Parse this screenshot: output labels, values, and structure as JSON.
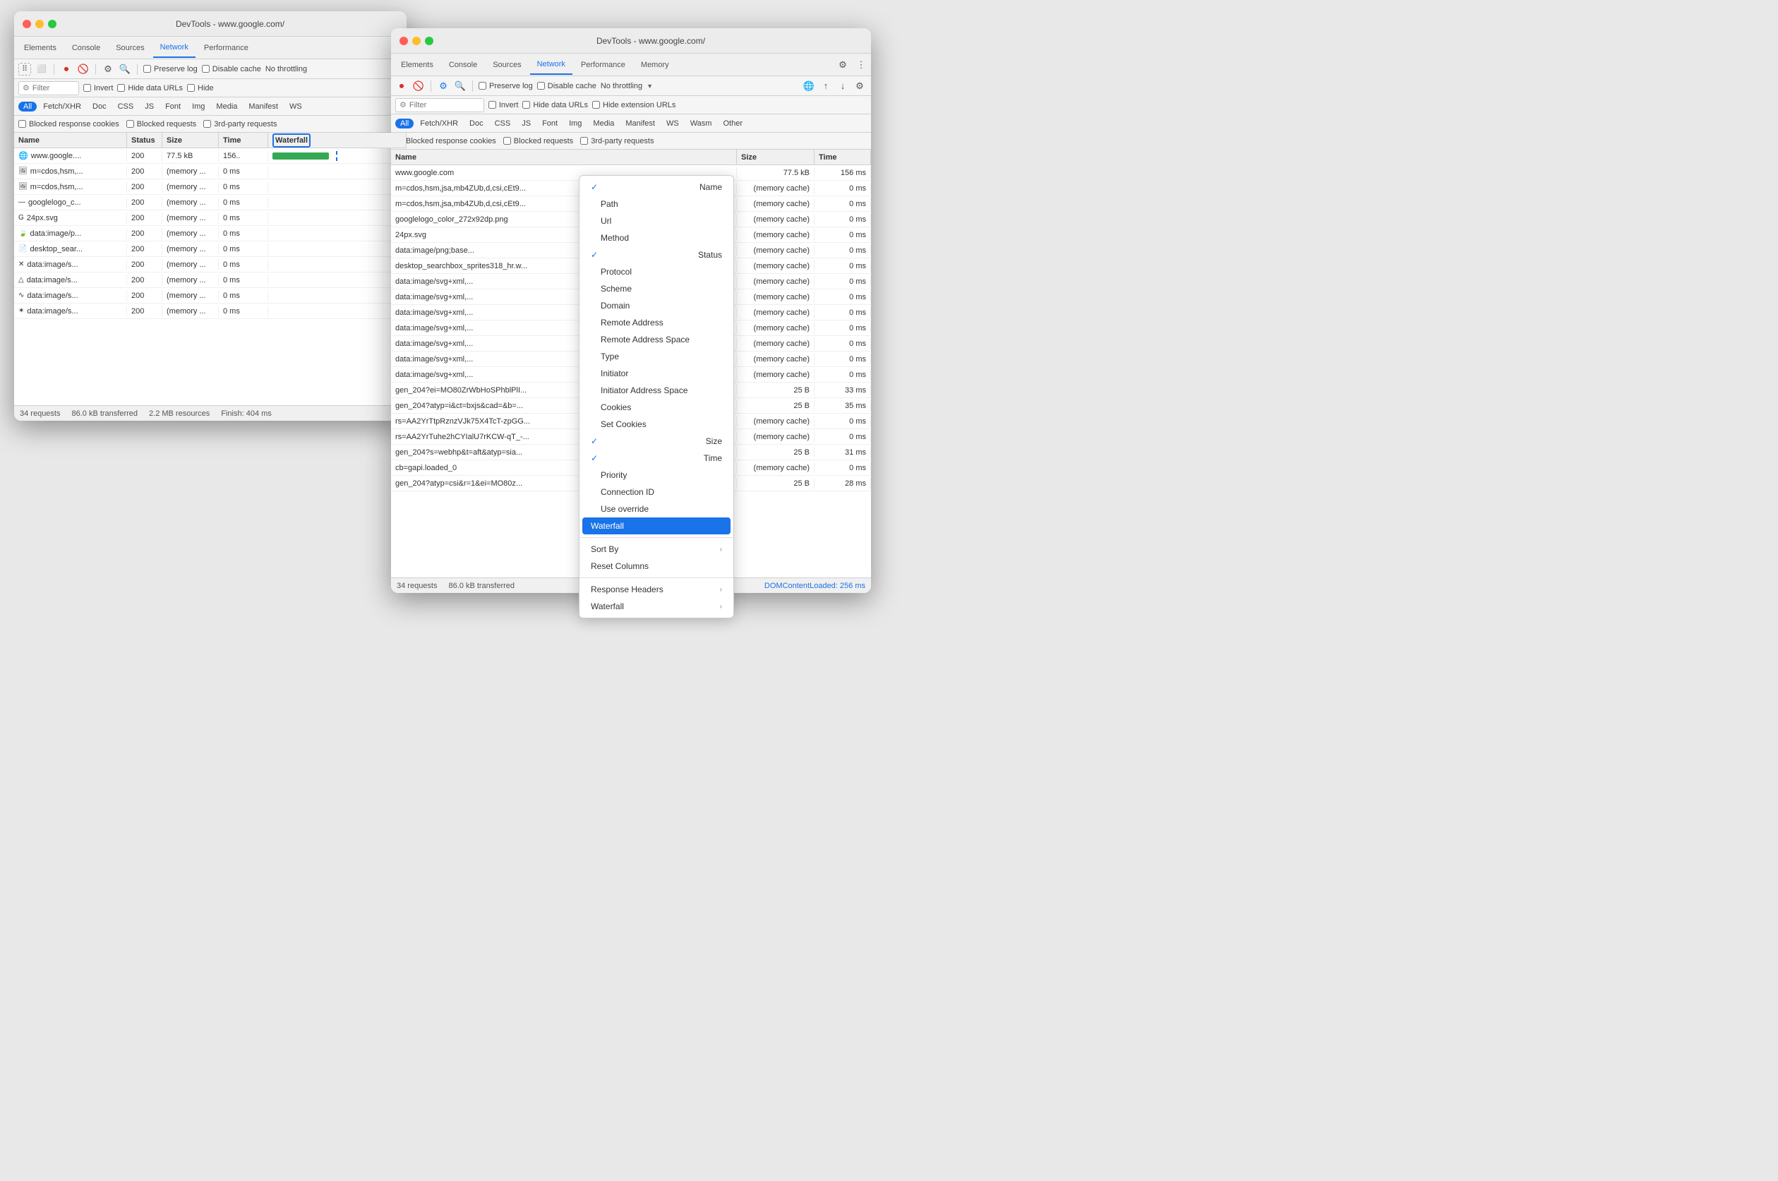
{
  "window1": {
    "title": "DevTools - www.google.com/",
    "tabs": [
      "Elements",
      "Console",
      "Sources",
      "Network",
      "Performance"
    ],
    "active_tab": "Network",
    "toolbar": {
      "record_tooltip": "Record",
      "clear_tooltip": "Clear",
      "filter_tooltip": "Filter",
      "search_tooltip": "Search",
      "preserve_log_label": "Preserve log",
      "disable_cache_label": "Disable cache",
      "throttle_label": "No throttling"
    },
    "filter": {
      "placeholder": "Filter",
      "invert_label": "Invert",
      "hide_data_urls_label": "Hide data URLs",
      "hide_label": "Hide"
    },
    "pills": [
      "All",
      "Fetch/XHR",
      "Doc",
      "CSS",
      "JS",
      "Font",
      "Img",
      "Media",
      "Manifest",
      "WS"
    ],
    "active_pill": "All",
    "blocked_row": {
      "blocked_cookies": "Blocked response cookies",
      "blocked_requests": "Blocked requests",
      "third_party": "3rd-party requests"
    },
    "columns": [
      "Name",
      "Status",
      "Size",
      "Time",
      "Waterfall"
    ],
    "rows": [
      {
        "icon": "globe",
        "name": "www.google....",
        "status": "200",
        "size": "77.5 kB",
        "time": "156..",
        "waterfall_type": "bar"
      },
      {
        "icon": "img",
        "name": "m=cdos,hsm,...",
        "status": "200",
        "size": "(memory ...",
        "time": "0 ms",
        "waterfall_type": "none"
      },
      {
        "icon": "img",
        "name": "m=cdos,hsm,...",
        "status": "200",
        "size": "(memory ...",
        "time": "0 ms",
        "waterfall_type": "none"
      },
      {
        "icon": "dash",
        "name": "googlelogo_c...",
        "status": "200",
        "size": "(memory ...",
        "time": "0 ms",
        "waterfall_type": "none"
      },
      {
        "icon": "g",
        "name": "24px.svg",
        "status": "200",
        "size": "(memory ...",
        "time": "0 ms",
        "waterfall_type": "none"
      },
      {
        "icon": "leaf",
        "name": "data:image/p...",
        "status": "200",
        "size": "(memory ...",
        "time": "0 ms",
        "waterfall_type": "none"
      },
      {
        "icon": "doc",
        "name": "desktop_sear...",
        "status": "200",
        "size": "(memory ...",
        "time": "0 ms",
        "waterfall_type": "none"
      },
      {
        "icon": "x",
        "name": "data:image/s...",
        "status": "200",
        "size": "(memory ...",
        "time": "0 ms",
        "waterfall_type": "none"
      },
      {
        "icon": "triangle",
        "name": "data:image/s...",
        "status": "200",
        "size": "(memory ...",
        "time": "0 ms",
        "waterfall_type": "none"
      },
      {
        "icon": "wave",
        "name": "data:image/s...",
        "status": "200",
        "size": "(memory ...",
        "time": "0 ms",
        "waterfall_type": "none"
      },
      {
        "icon": "asterisk",
        "name": "data:image/s...",
        "status": "200",
        "size": "(memory ...",
        "time": "0 ms",
        "waterfall_type": "none"
      }
    ],
    "status_bar": {
      "requests": "34 requests",
      "transferred": "86.0 kB transferred",
      "resources": "2.2 MB resources",
      "finish": "Finish: 404 ms"
    },
    "waterfall_header": "Waterfall"
  },
  "window2": {
    "title": "DevTools - www.google.com/",
    "tabs": [
      "Elements",
      "Console",
      "Sources",
      "Network",
      "Performance",
      "Memory"
    ],
    "active_tab": "Network",
    "toolbar": {
      "preserve_log_label": "Preserve log",
      "disable_cache_label": "Disable cache",
      "throttle_label": "No throttling"
    },
    "filter": {
      "placeholder": "Filter",
      "invert_label": "Invert",
      "hide_data_urls_label": "Hide data URLs",
      "hide_extension_label": "Hide extension URLs"
    },
    "pills": [
      "All",
      "Fetch/XHR",
      "Doc",
      "CSS",
      "JS",
      "Font",
      "Img",
      "Media",
      "Manifest",
      "WS",
      "Wasm",
      "Other"
    ],
    "active_pill": "All",
    "blocked_row": {
      "blocked_cookies": "Blocked response cookies",
      "blocked_requests": "Blocked requests",
      "third_party": "3rd-party requests"
    },
    "columns": [
      "Name",
      "",
      "Time"
    ],
    "rows": [
      {
        "name": "www.google.com",
        "size": "77.5 kB",
        "time": "156 ms"
      },
      {
        "name": "m=cdos,hsm,jsa,mb4ZUb,d,csi,cEt9...",
        "size": "(memory cache)",
        "time": "0 ms"
      },
      {
        "name": "m=cdos,hsm,jsa,mb4ZUb,d,csi,cEt9...",
        "size": "(memory cache)",
        "time": "0 ms"
      },
      {
        "name": "googlelogo_color_272x92dp.png",
        "size": "(memory cache)",
        "time": "0 ms"
      },
      {
        "name": "24px.svg",
        "size": "(memory cache)",
        "time": "0 ms"
      },
      {
        "name": "data:image/png;base...",
        "size": "(memory cache)",
        "time": "0 ms"
      },
      {
        "name": "desktop_searchbox_sprites318_hr.w...",
        "size": "(memory cache)",
        "time": "0 ms"
      },
      {
        "name": "data:image/svg+xml,...",
        "size": "(memory cache)",
        "time": "0 ms"
      },
      {
        "name": "data:image/svg+xml,...",
        "size": "(memory cache)",
        "time": "0 ms"
      },
      {
        "name": "data:image/svg+xml,...",
        "size": "(memory cache)",
        "time": "0 ms"
      },
      {
        "name": "data:image/svg+xml,...",
        "size": "(memory cache)",
        "time": "0 ms"
      },
      {
        "name": "data:image/svg+xml,...",
        "size": "(memory cache)",
        "time": "0 ms"
      },
      {
        "name": "data:image/svg+xml,...",
        "size": "(memory cache)",
        "time": "0 ms"
      },
      {
        "name": "data:image/svg+xml,...",
        "size": "(memory cache)",
        "time": "0 ms"
      },
      {
        "name": "gen_204?ei=MO80ZrWbHoSPhblPlI...",
        "size": "25 B",
        "time": "33 ms"
      },
      {
        "name": "gen_204?atyp=i&ct=bxjs&cad=&b=...",
        "size": "25 B",
        "time": "35 ms"
      },
      {
        "name": "rs=AA2YrTtpRznzVJk75X4TcT-zpGG...",
        "size": "(memory cache)",
        "time": "0 ms"
      },
      {
        "name": "rs=AA2YrTuhe2hCYIalU7rKCW-qT_-...",
        "size": "(memory cache)",
        "time": "0 ms"
      },
      {
        "name": "gen_204?s=webhp&t=aft&atyp=sia...",
        "size": "25 B",
        "time": "31 ms"
      },
      {
        "name": "cb=gapi.loaded_0",
        "size": "(memory cache)",
        "time": "0 ms"
      },
      {
        "name": "gen_204?atyp=csi&r=1&ei=MO80z...",
        "size": "25 B",
        "time": "28 ms"
      }
    ],
    "status_bar": {
      "requests": "34 requests",
      "transferred": "86.0 kB transferred",
      "dom_content": "DOMContentLoaded: 256 ms"
    }
  },
  "context_menu": {
    "items": [
      {
        "label": "Name",
        "checked": true,
        "type": "item"
      },
      {
        "label": "Path",
        "checked": false,
        "type": "item"
      },
      {
        "label": "Url",
        "checked": false,
        "type": "item"
      },
      {
        "label": "Method",
        "checked": false,
        "type": "item"
      },
      {
        "label": "Status",
        "checked": true,
        "type": "item"
      },
      {
        "label": "Protocol",
        "checked": false,
        "type": "item"
      },
      {
        "label": "Scheme",
        "checked": false,
        "type": "item"
      },
      {
        "label": "Domain",
        "checked": false,
        "type": "item"
      },
      {
        "label": "Remote Address",
        "checked": false,
        "type": "item"
      },
      {
        "label": "Remote Address Space",
        "checked": false,
        "type": "item"
      },
      {
        "label": "Type",
        "checked": false,
        "type": "item"
      },
      {
        "label": "Initiator",
        "checked": false,
        "type": "item"
      },
      {
        "label": "Initiator Address Space",
        "checked": false,
        "type": "item"
      },
      {
        "label": "Cookies",
        "checked": false,
        "type": "item"
      },
      {
        "label": "Set Cookies",
        "checked": false,
        "type": "item"
      },
      {
        "label": "Size",
        "checked": true,
        "type": "item"
      },
      {
        "label": "Time",
        "checked": true,
        "type": "item"
      },
      {
        "label": "Priority",
        "checked": false,
        "type": "item"
      },
      {
        "label": "Connection ID",
        "checked": false,
        "type": "item"
      },
      {
        "label": "Use override",
        "checked": false,
        "type": "item"
      },
      {
        "label": "Waterfall",
        "checked": false,
        "highlighted": true,
        "type": "item"
      },
      {
        "label": "Sort By",
        "type": "submenu"
      },
      {
        "label": "Reset Columns",
        "type": "item"
      },
      {
        "label": "Response Headers",
        "type": "submenu"
      },
      {
        "label": "Waterfall",
        "type": "submenu"
      }
    ]
  },
  "icons": {
    "record": "⏺",
    "clear": "🚫",
    "filter": "⚙",
    "search": "🔍",
    "gear": "⚙",
    "more": "⋮",
    "chevron": "›",
    "down_arrow": "▼",
    "upload": "↑",
    "download": "↓",
    "screenshot": "📷"
  }
}
